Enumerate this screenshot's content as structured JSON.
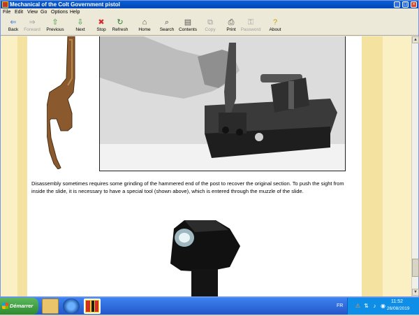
{
  "window": {
    "title": "Mechanical of the Colt Government pistol",
    "controls": {
      "minimize": "_",
      "maximize": "□",
      "close": "×"
    }
  },
  "menu": [
    "File",
    "Edit",
    "View",
    "Go",
    "Options",
    "Help"
  ],
  "toolbar": [
    {
      "label": "Back",
      "icon": "arrow-left-icon",
      "glyph": "⇐",
      "color": "#3a7bd5",
      "enabled": true
    },
    {
      "label": "Forward",
      "icon": "arrow-right-icon",
      "glyph": "⇒",
      "color": "#a0a0a0",
      "enabled": false
    },
    {
      "label": "Previous",
      "icon": "arrow-up-icon",
      "glyph": "⇧",
      "color": "#2e9a2e",
      "enabled": true
    },
    {
      "label": "Next",
      "icon": "arrow-down-icon",
      "glyph": "⇩",
      "color": "#2e9a2e",
      "enabled": true
    },
    {
      "label": "Stop",
      "icon": "stop-icon",
      "glyph": "✖",
      "color": "#d62b2b",
      "enabled": true
    },
    {
      "label": "Refresh",
      "icon": "refresh-icon",
      "glyph": "↻",
      "color": "#2e7a2e",
      "enabled": true
    },
    {
      "label": "Home",
      "icon": "home-icon",
      "glyph": "⌂",
      "color": "#6b4a2a",
      "enabled": true
    },
    {
      "label": "Search",
      "icon": "search-icon",
      "glyph": "⌕",
      "color": "#444444",
      "enabled": true
    },
    {
      "label": "Contents",
      "icon": "contents-icon",
      "glyph": "▤",
      "color": "#555555",
      "enabled": true
    },
    {
      "label": "Copy",
      "icon": "copy-icon",
      "glyph": "⧉",
      "color": "#a0a0a0",
      "enabled": false
    },
    {
      "label": "Print",
      "icon": "print-icon",
      "glyph": "⎙",
      "color": "#444444",
      "enabled": true
    },
    {
      "label": "Password",
      "icon": "key-icon",
      "glyph": "⚿",
      "color": "#a0a0a0",
      "enabled": false
    },
    {
      "label": "About",
      "icon": "help-icon",
      "glyph": "?",
      "color": "#c9a100",
      "enabled": true
    }
  ],
  "content": {
    "paragraph": "Disassembly sometimes requires some grinding of the hammered end of the post to recover the original section. To push the sight from inside the slide, it is necessary to have a special tool (shown above), which is entered through the muzzle of the slide."
  },
  "taskbar": {
    "start_label": "Démarrer",
    "language": "FR",
    "time": "11:52",
    "date": "26/08/2019"
  },
  "colors": {
    "gold_margin": "#f3e2a0",
    "title_bar": "#0b5fd6",
    "taskbar": "#2456c8"
  }
}
